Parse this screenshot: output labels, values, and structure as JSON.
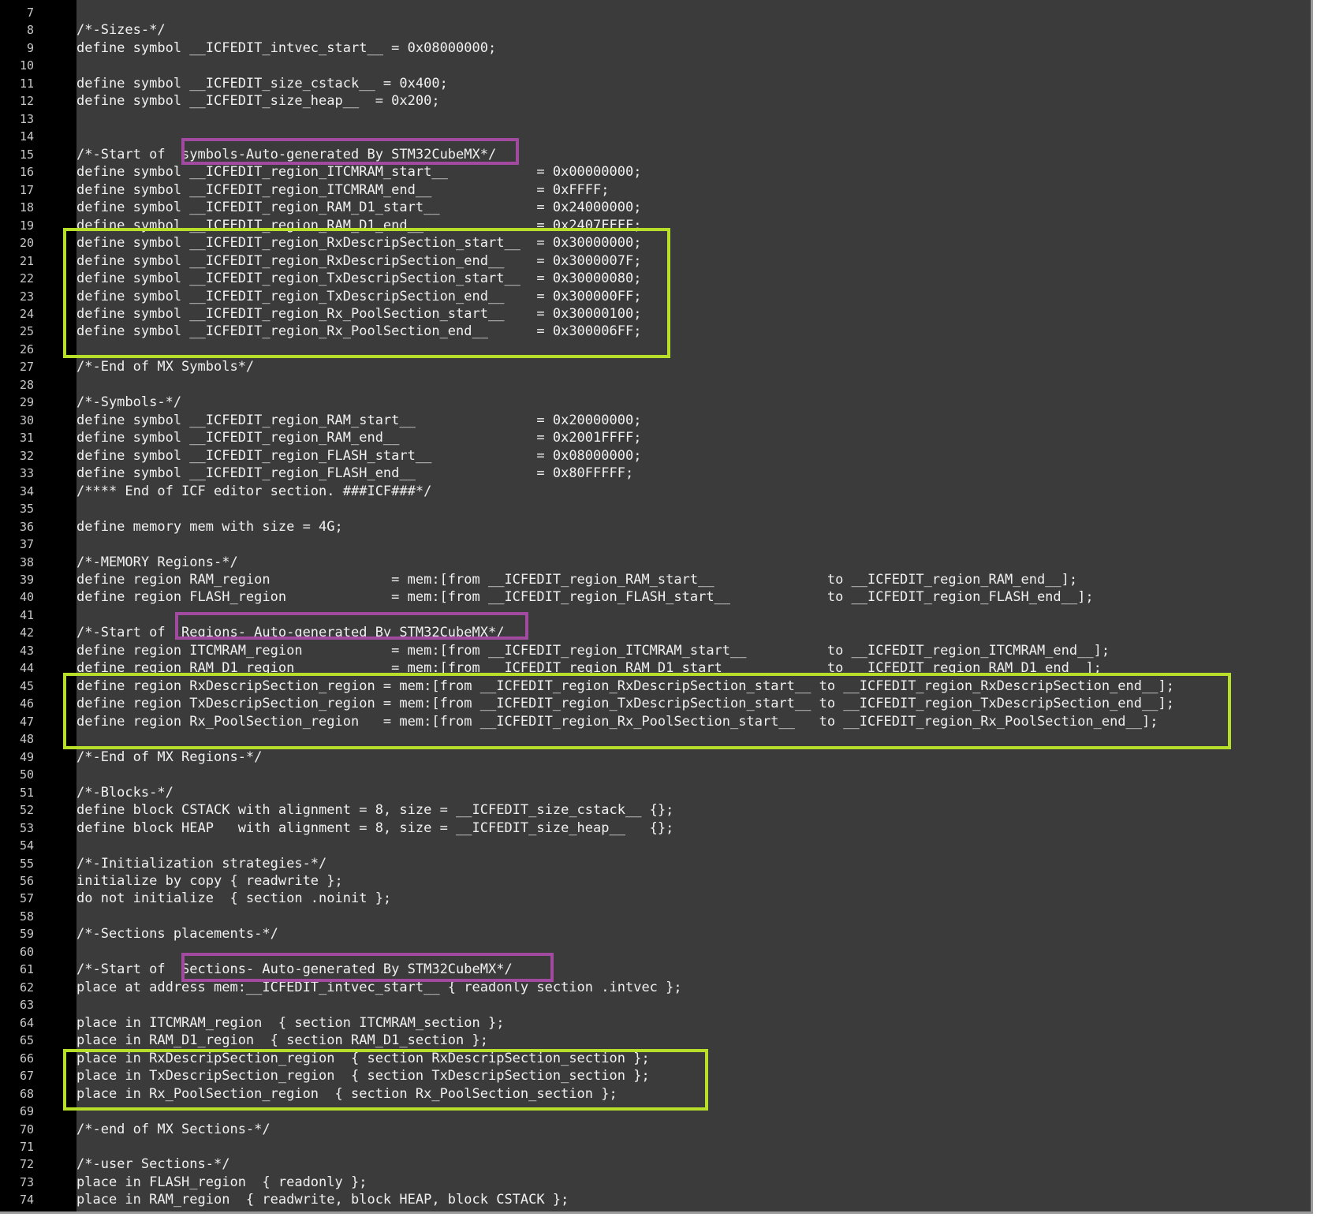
{
  "colors": {
    "editor_background": "#3b3b3b",
    "gutter_background": "#000000",
    "text": "#f0f0f0",
    "line_number": "#c8c8c8",
    "highlight_purple": "#a24a9f",
    "highlight_green": "#b7df2a"
  },
  "lines": [
    {
      "n": "7",
      "t": ""
    },
    {
      "n": "8",
      "t": "/*-Sizes-*/"
    },
    {
      "n": "9",
      "t": "define symbol __ICFEDIT_intvec_start__ = 0x08000000;"
    },
    {
      "n": "10",
      "t": ""
    },
    {
      "n": "11",
      "t": "define symbol __ICFEDIT_size_cstack__ = 0x400;"
    },
    {
      "n": "12",
      "t": "define symbol __ICFEDIT_size_heap__  = 0x200;"
    },
    {
      "n": "13",
      "t": ""
    },
    {
      "n": "14",
      "t": ""
    },
    {
      "n": "15",
      "t": "/*-Start of  symbols-Auto-generated By STM32CubeMX*/"
    },
    {
      "n": "16",
      "t": "define symbol __ICFEDIT_region_ITCMRAM_start__           = 0x00000000;"
    },
    {
      "n": "17",
      "t": "define symbol __ICFEDIT_region_ITCMRAM_end__             = 0xFFFF;"
    },
    {
      "n": "18",
      "t": "define symbol __ICFEDIT_region_RAM_D1_start__            = 0x24000000;"
    },
    {
      "n": "19",
      "t": "define symbol __ICFEDIT_region_RAM_D1_end__              = 0x2407FFFF;"
    },
    {
      "n": "20",
      "t": "define symbol __ICFEDIT_region_RxDescripSection_start__  = 0x30000000;"
    },
    {
      "n": "21",
      "t": "define symbol __ICFEDIT_region_RxDescripSection_end__    = 0x3000007F;"
    },
    {
      "n": "22",
      "t": "define symbol __ICFEDIT_region_TxDescripSection_start__  = 0x30000080;"
    },
    {
      "n": "23",
      "t": "define symbol __ICFEDIT_region_TxDescripSection_end__    = 0x300000FF;"
    },
    {
      "n": "24",
      "t": "define symbol __ICFEDIT_region_Rx_PoolSection_start__    = 0x30000100;"
    },
    {
      "n": "25",
      "t": "define symbol __ICFEDIT_region_Rx_PoolSection_end__      = 0x300006FF;"
    },
    {
      "n": "26",
      "t": ""
    },
    {
      "n": "27",
      "t": "/*-End of MX Symbols*/"
    },
    {
      "n": "28",
      "t": ""
    },
    {
      "n": "29",
      "t": "/*-Symbols-*/"
    },
    {
      "n": "30",
      "t": "define symbol __ICFEDIT_region_RAM_start__               = 0x20000000;"
    },
    {
      "n": "31",
      "t": "define symbol __ICFEDIT_region_RAM_end__                 = 0x2001FFFF;"
    },
    {
      "n": "32",
      "t": "define symbol __ICFEDIT_region_FLASH_start__             = 0x08000000;"
    },
    {
      "n": "33",
      "t": "define symbol __ICFEDIT_region_FLASH_end__               = 0x80FFFFF;"
    },
    {
      "n": "34",
      "t": "/**** End of ICF editor section. ###ICF###*/"
    },
    {
      "n": "35",
      "t": ""
    },
    {
      "n": "36",
      "t": "define memory mem with size = 4G;"
    },
    {
      "n": "37",
      "t": ""
    },
    {
      "n": "38",
      "t": "/*-MEMORY Regions-*/"
    },
    {
      "n": "39",
      "t": "define region RAM_region               = mem:[from __ICFEDIT_region_RAM_start__              to __ICFEDIT_region_RAM_end__];"
    },
    {
      "n": "40",
      "t": "define region FLASH_region             = mem:[from __ICFEDIT_region_FLASH_start__            to __ICFEDIT_region_FLASH_end__];"
    },
    {
      "n": "41",
      "t": ""
    },
    {
      "n": "42",
      "t": "/*-Start of  Regions- Auto-generated By STM32CubeMX*/"
    },
    {
      "n": "43",
      "t": "define region ITCMRAM_region           = mem:[from __ICFEDIT_region_ITCMRAM_start__          to __ICFEDIT_region_ITCMRAM_end__];"
    },
    {
      "n": "44",
      "t": "define region RAM_D1_region            = mem:[from __ICFEDIT_region_RAM_D1_start__           to __ICFEDIT_region_RAM_D1_end__];"
    },
    {
      "n": "45",
      "t": "define region RxDescripSection_region = mem:[from __ICFEDIT_region_RxDescripSection_start__ to __ICFEDIT_region_RxDescripSection_end__];"
    },
    {
      "n": "46",
      "t": "define region TxDescripSection_region = mem:[from __ICFEDIT_region_TxDescripSection_start__ to __ICFEDIT_region_TxDescripSection_end__];"
    },
    {
      "n": "47",
      "t": "define region Rx_PoolSection_region   = mem:[from __ICFEDIT_region_Rx_PoolSection_start__   to __ICFEDIT_region_Rx_PoolSection_end__];"
    },
    {
      "n": "48",
      "t": ""
    },
    {
      "n": "49",
      "t": "/*-End of MX Regions-*/"
    },
    {
      "n": "50",
      "t": ""
    },
    {
      "n": "51",
      "t": "/*-Blocks-*/"
    },
    {
      "n": "52",
      "t": "define block CSTACK with alignment = 8, size = __ICFEDIT_size_cstack__ {};"
    },
    {
      "n": "53",
      "t": "define block HEAP   with alignment = 8, size = __ICFEDIT_size_heap__   {};"
    },
    {
      "n": "54",
      "t": ""
    },
    {
      "n": "55",
      "t": "/*-Initialization strategies-*/"
    },
    {
      "n": "56",
      "t": "initialize by copy { readwrite };"
    },
    {
      "n": "57",
      "t": "do not initialize  { section .noinit };"
    },
    {
      "n": "58",
      "t": ""
    },
    {
      "n": "59",
      "t": "/*-Sections placements-*/"
    },
    {
      "n": "60",
      "t": ""
    },
    {
      "n": "61",
      "t": "/*-Start of  Sections- Auto-generated By STM32CubeMX*/"
    },
    {
      "n": "62",
      "t": "place at address mem:__ICFEDIT_intvec_start__ { readonly section .intvec };"
    },
    {
      "n": "63",
      "t": ""
    },
    {
      "n": "64",
      "t": "place in ITCMRAM_region  { section ITCMRAM_section };"
    },
    {
      "n": "65",
      "t": "place in RAM_D1_region  { section RAM_D1_section };"
    },
    {
      "n": "66",
      "t": "place in RxDescripSection_region  { section RxDescripSection_section };"
    },
    {
      "n": "67",
      "t": "place in TxDescripSection_region  { section TxDescripSection_section };"
    },
    {
      "n": "68",
      "t": "place in Rx_PoolSection_region  { section Rx_PoolSection_section };"
    },
    {
      "n": "69",
      "t": ""
    },
    {
      "n": "70",
      "t": "/*-end of MX Sections-*/"
    },
    {
      "n": "71",
      "t": ""
    },
    {
      "n": "72",
      "t": "/*-user Sections-*/"
    },
    {
      "n": "73",
      "t": "place in FLASH_region  { readonly };"
    },
    {
      "n": "74",
      "t": "place in RAM_region  { readwrite, block HEAP, block CSTACK };"
    }
  ]
}
